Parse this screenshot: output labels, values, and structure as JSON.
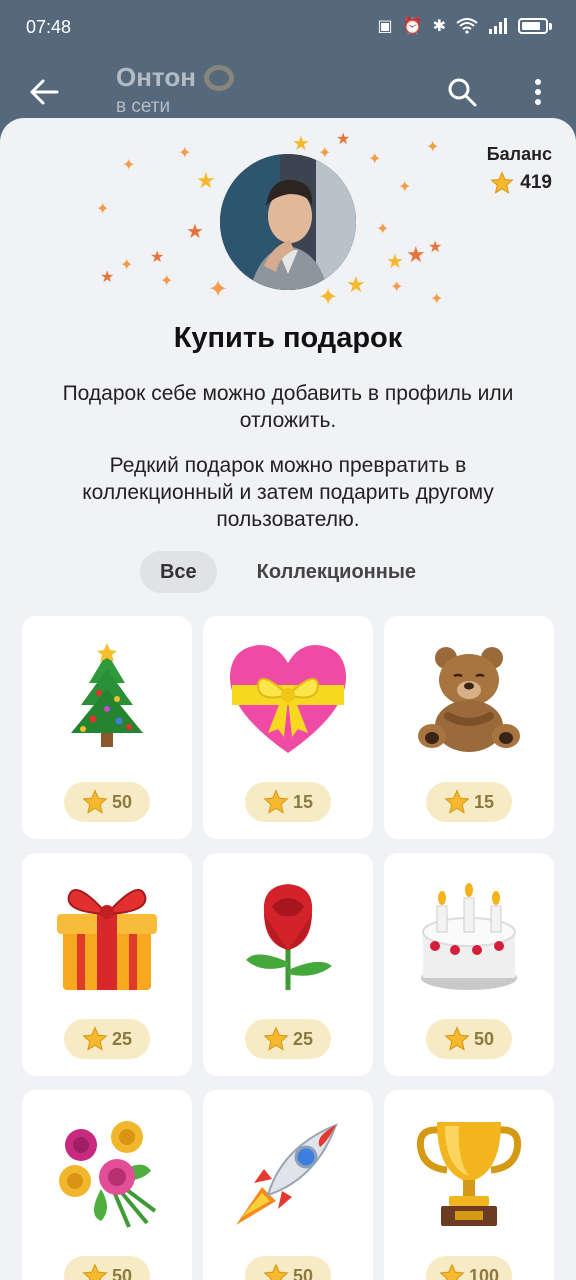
{
  "status_bar": {
    "time": "07:48"
  },
  "header": {
    "title": "Онтон",
    "subtitle": "в сети"
  },
  "balance": {
    "label": "Баланс",
    "value": "419"
  },
  "heading": "Купить подарок",
  "description_1": "Подарок себе можно добавить в профиль или отложить.",
  "description_2": "Редкий подарок можно превратить в коллекционный и затем подарить другому пользователю.",
  "tabs": [
    {
      "label": "Все"
    },
    {
      "label": "Коллекционные"
    }
  ],
  "gifts": [
    {
      "name": "christmas-tree",
      "price": "50"
    },
    {
      "name": "heart",
      "price": "15"
    },
    {
      "name": "teddy-bear",
      "price": "15"
    },
    {
      "name": "gift-box",
      "price": "25"
    },
    {
      "name": "rose",
      "price": "25"
    },
    {
      "name": "cake",
      "price": "50"
    },
    {
      "name": "flowers",
      "price": "50"
    },
    {
      "name": "rocket",
      "price": "50"
    },
    {
      "name": "trophy",
      "price": "100"
    }
  ],
  "colors": {
    "header_bg": "#56687c",
    "sheet_bg": "#f1f2f5",
    "star": "#f5b82e",
    "pill_bg": "#f7ebc5"
  }
}
